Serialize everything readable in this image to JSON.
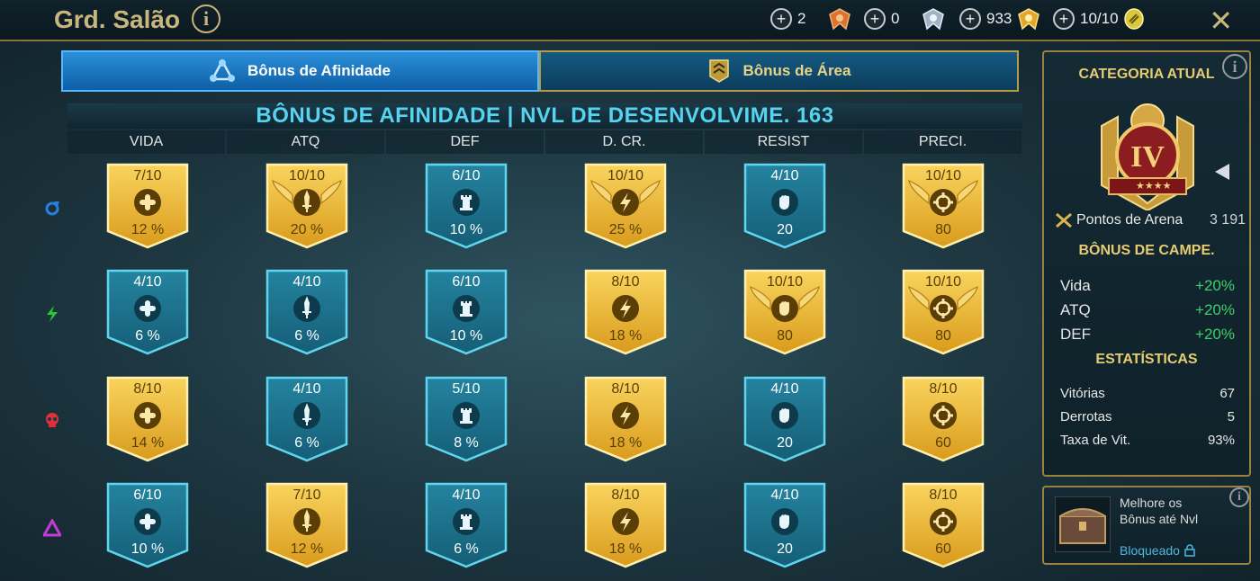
{
  "header": {
    "title": "Grd. Salão",
    "resources": [
      {
        "value": "2",
        "icon": "bronze-medal-icon"
      },
      {
        "value": "0",
        "icon": "silver-medal-icon"
      },
      {
        "value": "933",
        "icon": "gold-medal-icon"
      },
      {
        "value": "10/10",
        "icon": "arena-token-icon"
      }
    ]
  },
  "tabs": [
    {
      "label": "Bônus de Afinidade",
      "active": true
    },
    {
      "label": "Bônus de Área",
      "active": false
    }
  ],
  "table": {
    "title": "BÔNUS DE AFINIDADE | NVL DE DESENVOLVIME. 163",
    "columns": [
      "VIDA",
      "ATQ",
      "DEF",
      "D. CR.",
      "RESIST",
      "PRECI."
    ],
    "column_icons": [
      "hp-icon",
      "attack-icon",
      "defense-icon",
      "crit-damage-icon",
      "resistance-icon",
      "accuracy-icon"
    ],
    "rows": [
      {
        "affinity": "magic-affinity-icon",
        "color": "#2b7fe0",
        "cells": [
          {
            "rank": "7/10",
            "value": "12 %",
            "tier": "gold"
          },
          {
            "rank": "10/10",
            "value": "20 %",
            "tier": "gold"
          },
          {
            "rank": "6/10",
            "value": "10 %",
            "tier": "blue"
          },
          {
            "rank": "10/10",
            "value": "25 %",
            "tier": "gold"
          },
          {
            "rank": "4/10",
            "value": "20",
            "tier": "blue"
          },
          {
            "rank": "10/10",
            "value": "80",
            "tier": "gold"
          }
        ]
      },
      {
        "affinity": "force-affinity-icon",
        "color": "#2ec43a",
        "cells": [
          {
            "rank": "4/10",
            "value": "6 %",
            "tier": "blue"
          },
          {
            "rank": "4/10",
            "value": "6 %",
            "tier": "blue"
          },
          {
            "rank": "6/10",
            "value": "10 %",
            "tier": "blue"
          },
          {
            "rank": "8/10",
            "value": "18 %",
            "tier": "gold"
          },
          {
            "rank": "10/10",
            "value": "80",
            "tier": "gold"
          },
          {
            "rank": "10/10",
            "value": "80",
            "tier": "gold"
          }
        ]
      },
      {
        "affinity": "spirit-affinity-icon",
        "color": "#e0303a",
        "cells": [
          {
            "rank": "8/10",
            "value": "14 %",
            "tier": "gold"
          },
          {
            "rank": "4/10",
            "value": "6 %",
            "tier": "blue"
          },
          {
            "rank": "5/10",
            "value": "8 %",
            "tier": "blue"
          },
          {
            "rank": "8/10",
            "value": "18 %",
            "tier": "gold"
          },
          {
            "rank": "4/10",
            "value": "20",
            "tier": "blue"
          },
          {
            "rank": "8/10",
            "value": "60",
            "tier": "gold"
          }
        ]
      },
      {
        "affinity": "void-affinity-icon",
        "color": "#c43ad8",
        "cells": [
          {
            "rank": "6/10",
            "value": "10 %",
            "tier": "blue"
          },
          {
            "rank": "7/10",
            "value": "12 %",
            "tier": "gold"
          },
          {
            "rank": "4/10",
            "value": "6 %",
            "tier": "blue"
          },
          {
            "rank": "8/10",
            "value": "18 %",
            "tier": "gold"
          },
          {
            "rank": "4/10",
            "value": "20",
            "tier": "blue"
          },
          {
            "rank": "8/10",
            "value": "60",
            "tier": "gold"
          }
        ]
      }
    ]
  },
  "sidebar": {
    "category_title": "CATEGORIA ATUAL",
    "rank_numeral": "IV",
    "arena_points_label": "Pontos de Arena",
    "arena_points_value": "3 191",
    "champion_bonus_title": "BÔNUS DE CAMPE.",
    "bonuses": [
      {
        "label": "Vida",
        "value": "+20%"
      },
      {
        "label": "ATQ",
        "value": "+20%"
      },
      {
        "label": "DEF",
        "value": "+20%"
      }
    ],
    "stats_title": "ESTATÍSTICAS",
    "stats": [
      {
        "label": "Vitórias",
        "value": "67"
      },
      {
        "label": "Derrotas",
        "value": "5"
      },
      {
        "label": "Taxa de Vit.",
        "value": "93%"
      }
    ]
  },
  "upgrade_card": {
    "text_line1": "Melhore os",
    "text_line2": "Bônus até Nvl",
    "status": "Bloqueado"
  },
  "colors": {
    "gold": "#e9b92f",
    "blue": "#1f7f9c",
    "accent_title": "#57d3f0",
    "positive": "#3fd06a"
  }
}
